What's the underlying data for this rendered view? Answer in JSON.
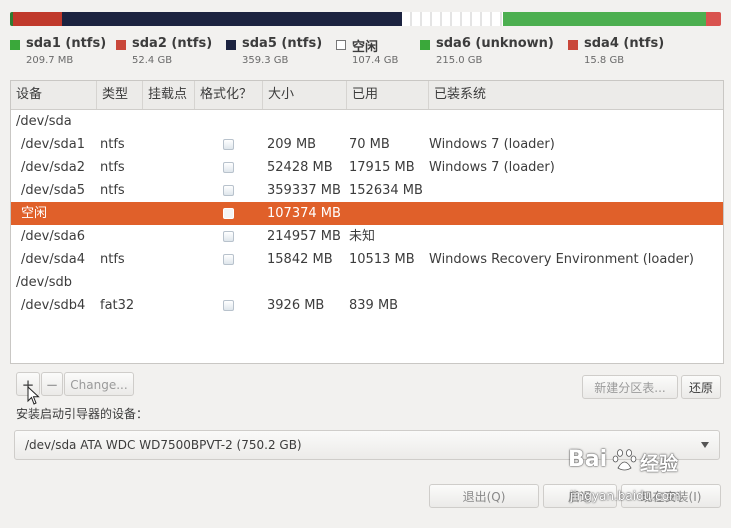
{
  "partition_bar": {
    "segments": [
      {
        "name": "sda1",
        "color": "#2e7d32",
        "fraction": 0.004
      },
      {
        "name": "sda2",
        "color": "#c0392b",
        "fraction": 0.07
      },
      {
        "name": "sda5",
        "color": "#1c2340",
        "fraction": 0.48
      },
      {
        "name": "free",
        "color": "#ffffff",
        "fraction": 0.143
      },
      {
        "name": "sda6",
        "color": "#4caf50",
        "fraction": 0.287
      },
      {
        "name": "sda4",
        "color": "#d9534f",
        "fraction": 0.021
      }
    ]
  },
  "legend": [
    {
      "name": "sda1 (ntfs)",
      "size": "209.7 MB",
      "color": "#3aa83a",
      "outline": false
    },
    {
      "name": "sda2 (ntfs)",
      "size": "52.4 GB",
      "color": "#c9473a",
      "outline": false
    },
    {
      "name": "sda5 (ntfs)",
      "size": "359.3 GB",
      "color": "#1c2340",
      "outline": false
    },
    {
      "name": "空闲",
      "size": "107.4 GB",
      "color": "#ffffff",
      "outline": true
    },
    {
      "name": "sda6 (unknown)",
      "size": "215.0 GB",
      "color": "#3aa83a",
      "outline": false
    },
    {
      "name": "sda4 (ntfs)",
      "size": "15.8 GB",
      "color": "#c9473a",
      "outline": false
    }
  ],
  "table": {
    "headers": [
      "设备",
      "类型",
      "挂载点",
      "格式化？",
      "大小",
      "已用",
      "已装系统"
    ],
    "rows": [
      {
        "device": "/dev/sda",
        "type": "",
        "mount": "",
        "format": false,
        "size": "",
        "used": "",
        "system": "",
        "group": true
      },
      {
        "device": "/dev/sda1",
        "type": "ntfs",
        "mount": "",
        "format": true,
        "size": "209 MB",
        "used": "70 MB",
        "system": "Windows 7 (loader)"
      },
      {
        "device": "/dev/sda2",
        "type": "ntfs",
        "mount": "",
        "format": true,
        "size": "52428 MB",
        "used": "17915 MB",
        "system": "Windows 7 (loader)"
      },
      {
        "device": "/dev/sda5",
        "type": "ntfs",
        "mount": "",
        "format": true,
        "size": "359337 MB",
        "used": "152634 MB",
        "system": ""
      },
      {
        "device": "空闲",
        "type": "",
        "mount": "",
        "format": true,
        "size": "107374 MB",
        "used": "",
        "system": "",
        "selected": true
      },
      {
        "device": "/dev/sda6",
        "type": "",
        "mount": "",
        "format": true,
        "size": "214957 MB",
        "used": "未知",
        "system": ""
      },
      {
        "device": "/dev/sda4",
        "type": "ntfs",
        "mount": "",
        "format": true,
        "size": "15842 MB",
        "used": "10513 MB",
        "system": "Windows Recovery Environment (loader)"
      },
      {
        "device": "/dev/sdb",
        "type": "",
        "mount": "",
        "format": false,
        "size": "",
        "used": "",
        "system": "",
        "group": true
      },
      {
        "device": "/dev/sdb4",
        "type": "fat32",
        "mount": "",
        "format": true,
        "size": "3926 MB",
        "used": "839 MB",
        "system": ""
      }
    ]
  },
  "toolbar": {
    "add": "+",
    "remove": "−",
    "change": "Change...",
    "new_table": "新建分区表...",
    "revert": "还原"
  },
  "bootloader": {
    "label": "安装启动引导器的设备：",
    "selected": "/dev/sda   ATA WDC WD7500BPVT-2 (750.2 GB)"
  },
  "footer": {
    "quit": "退出(Q)",
    "back": "后退",
    "install": "现在安装(I)"
  },
  "watermark": {
    "brand": "Bai",
    "brand_suffix": "百",
    "jingyan": "经验",
    "url": "jingyan.baidu.com"
  }
}
